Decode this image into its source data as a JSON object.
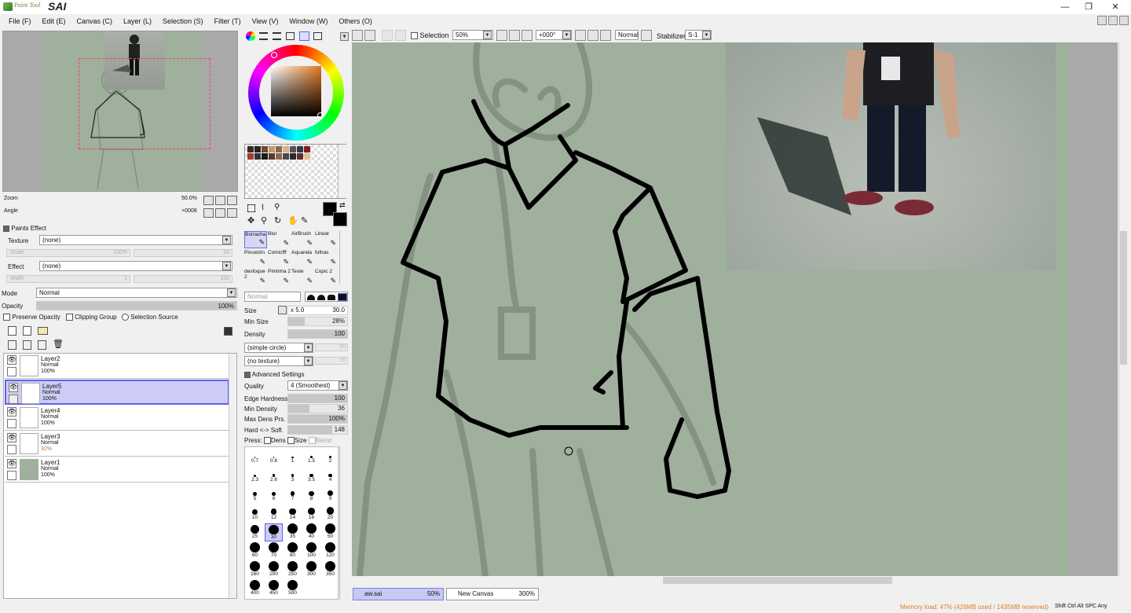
{
  "app": {
    "logo_small": "Paint Tool",
    "logo_main": "SAI"
  },
  "window_controls": {
    "minimize": "—",
    "restore": "❐",
    "close": "✕"
  },
  "menu": [
    "File (F)",
    "Edit (E)",
    "Canvas (C)",
    "Layer (L)",
    "Selection (S)",
    "Filter (T)",
    "View (V)",
    "Window (W)",
    "Others (O)"
  ],
  "navigator": {
    "zoom_label": "Zoom",
    "zoom_value": "50.0%",
    "angle_label": "Angle",
    "angle_value": "+0008"
  },
  "paint_effects": {
    "header": "Paints Effect",
    "texture_label": "Texture",
    "texture_value": "(none)",
    "scale_label": "Scale",
    "scale_value": "100%",
    "scale_right": "20",
    "effect_label": "Effect",
    "effect_value": "(none)",
    "width_label": "Width",
    "width_value": "1",
    "width_right": "100"
  },
  "layer_props": {
    "mode_label": "Mode",
    "mode_value": "Normal",
    "opacity_label": "Opacity",
    "opacity_value": "100%",
    "preserve_opacity": "Preserve Opacity",
    "clipping_group": "Clipping Group",
    "selection_source": "Selection Source"
  },
  "layers": [
    {
      "name": "Layer2",
      "mode": "Normal",
      "opacity": "100%",
      "selected": false
    },
    {
      "name": "Layer5",
      "mode": "Normal",
      "opacity": "100%",
      "selected": true
    },
    {
      "name": "Layer4",
      "mode": "Normal",
      "opacity": "100%",
      "selected": false
    },
    {
      "name": "Layer3",
      "mode": "Normal",
      "opacity": "32%",
      "selected": false
    },
    {
      "name": "Layer1",
      "mode": "Normal",
      "opacity": "100%",
      "selected": false
    }
  ],
  "tools": [
    {
      "label": "Borracha",
      "selected": true
    },
    {
      "label": "Blur"
    },
    {
      "label": "AirBrush"
    },
    {
      "label": "Lineat"
    },
    {
      "label": "Pincelzin"
    },
    {
      "label": "Comicfff"
    },
    {
      "label": "Aquarela"
    },
    {
      "label": "folhas"
    },
    {
      "label": "desfoque 2"
    },
    {
      "label": "Pintinha 2"
    },
    {
      "label": "Teste"
    },
    {
      "label": "Copic 2"
    }
  ],
  "brush": {
    "blend_mode": "Normal",
    "size_label": "Size",
    "size_multiplier": "x 5.0",
    "size_value": "30.0",
    "min_size_label": "Min Size",
    "min_size_value": "28%",
    "density_label": "Density",
    "density_value": "100",
    "shape": "(simple circle)",
    "shape_value": "50",
    "texture": "(no texture)",
    "texture_value": "95",
    "advanced_header": "Advanced Settings",
    "quality_label": "Quality",
    "quality_value": "4 (Smoothest)",
    "edge_hardness_label": "Edge Hardness",
    "edge_hardness_value": "100",
    "min_density_label": "Min Density",
    "min_density_value": "36",
    "max_dens_label": "Max Dens Prs.",
    "max_dens_value": "100%",
    "hard_soft_label": "Hard <-> Soft",
    "hard_soft_value": "148",
    "press_label": "Press:",
    "press_dens": "Dens",
    "press_size": "Size",
    "press_blend": "Blend"
  },
  "brush_sizes": [
    "0.7",
    "0.8",
    "1",
    "1.5",
    "2",
    "2.3",
    "2.6",
    "3",
    "3.5",
    "4",
    "5",
    "6",
    "7",
    "8",
    "9",
    "10",
    "12",
    "14",
    "16",
    "20",
    "25",
    "30",
    "35",
    "40",
    "50",
    "60",
    "70",
    "80",
    "100",
    "120",
    "160",
    "200",
    "250",
    "300",
    "350",
    "400",
    "450",
    "500"
  ],
  "selected_brush_size": "30",
  "toolbar": {
    "selection_label": "Selection",
    "zoom_value": "50%",
    "angle_value": "+000°",
    "blend_mode": "Normal",
    "stabilizer_label": "Stabilizer",
    "stabilizer_value": "S-1"
  },
  "documents": [
    {
      "name": "aw.sai",
      "zoom": "50%",
      "active": true
    },
    {
      "name": "New Canvas",
      "zoom": "300%",
      "active": false
    }
  ],
  "status": {
    "memory": "Memory load: 47% (426MB used / 1435MB reserved)",
    "keys": [
      "Shift",
      "Ctrl",
      "Alt",
      "SPC",
      "Any"
    ]
  },
  "colors": {
    "accent": "#6060ef",
    "canvas": "#9fb09d",
    "memory_text": "#e08020"
  }
}
